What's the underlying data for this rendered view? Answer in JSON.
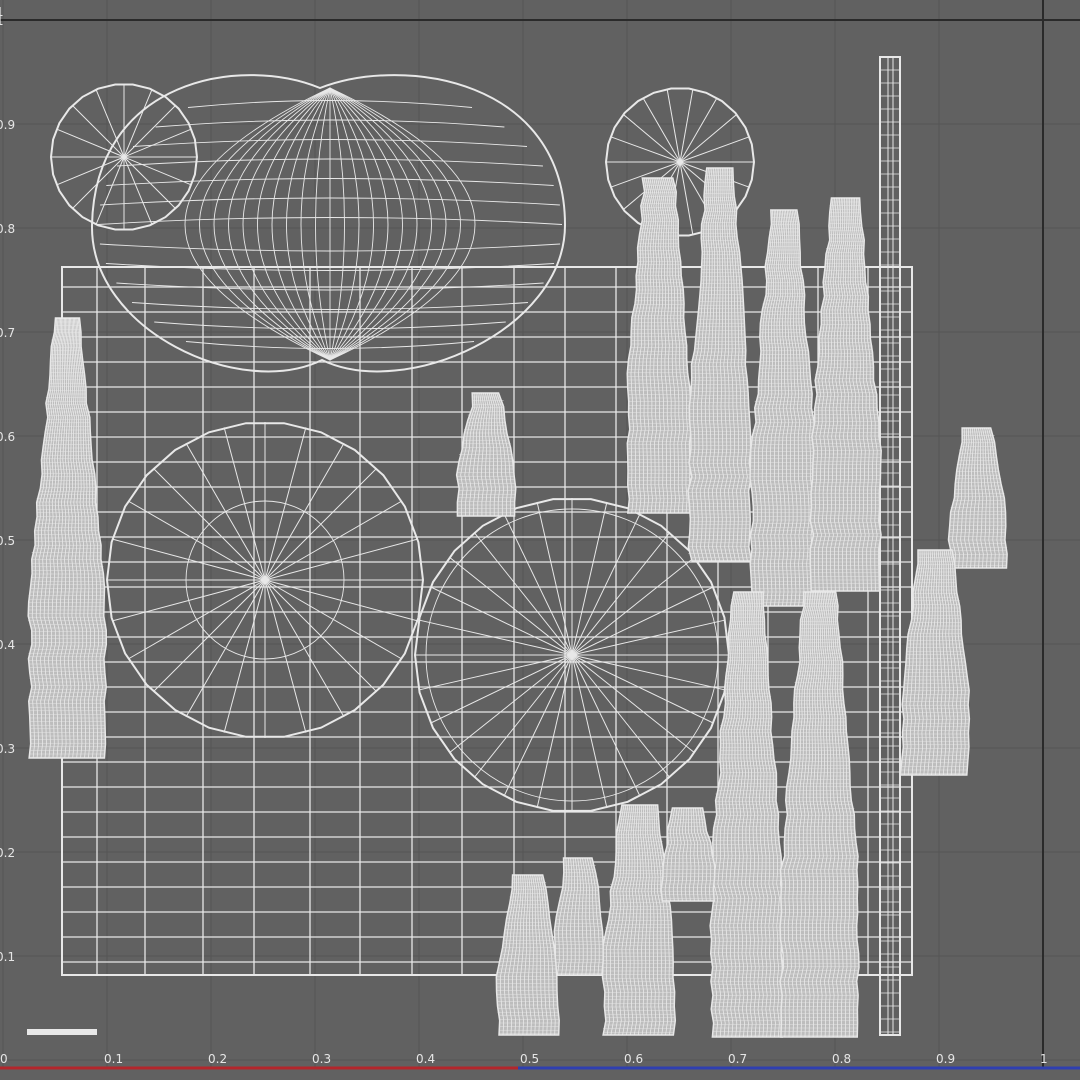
{
  "editor": {
    "colors": {
      "background": "#616161",
      "grid": "#555555",
      "wire": "#e8e8e8",
      "u_axis": "#b3262c",
      "v_axis": "#2f3fb0"
    },
    "u_ticks": [
      "0",
      "0.1",
      "0.2",
      "0.3",
      "0.4",
      "0.5",
      "0.6",
      "0.7",
      "0.8",
      "0.9",
      "1"
    ],
    "v_ticks": [
      "0.1",
      "0.2",
      "0.3",
      "0.4",
      "0.5",
      "0.6",
      "0.7",
      "0.8",
      "0.9",
      "1"
    ],
    "top_label": "1",
    "shells": [
      {
        "kind": "lattice",
        "name": "grid-mesh-shell"
      },
      {
        "kind": "pill",
        "name": "wrapped-sphere-shell"
      },
      {
        "kind": "disc",
        "name": "large-disc-shell-left"
      },
      {
        "kind": "disc",
        "name": "large-disc-shell-center"
      },
      {
        "kind": "disc",
        "name": "small-disc-shell-left"
      },
      {
        "kind": "disc",
        "name": "small-disc-shell-right"
      },
      {
        "kind": "strip",
        "name": "thin-strip-shell"
      },
      {
        "kind": "column",
        "name": "tall-column-shell"
      },
      {
        "kind": "column",
        "name": "short-column-shell"
      },
      {
        "kind": "column",
        "name": "column-shell-group"
      }
    ]
  }
}
